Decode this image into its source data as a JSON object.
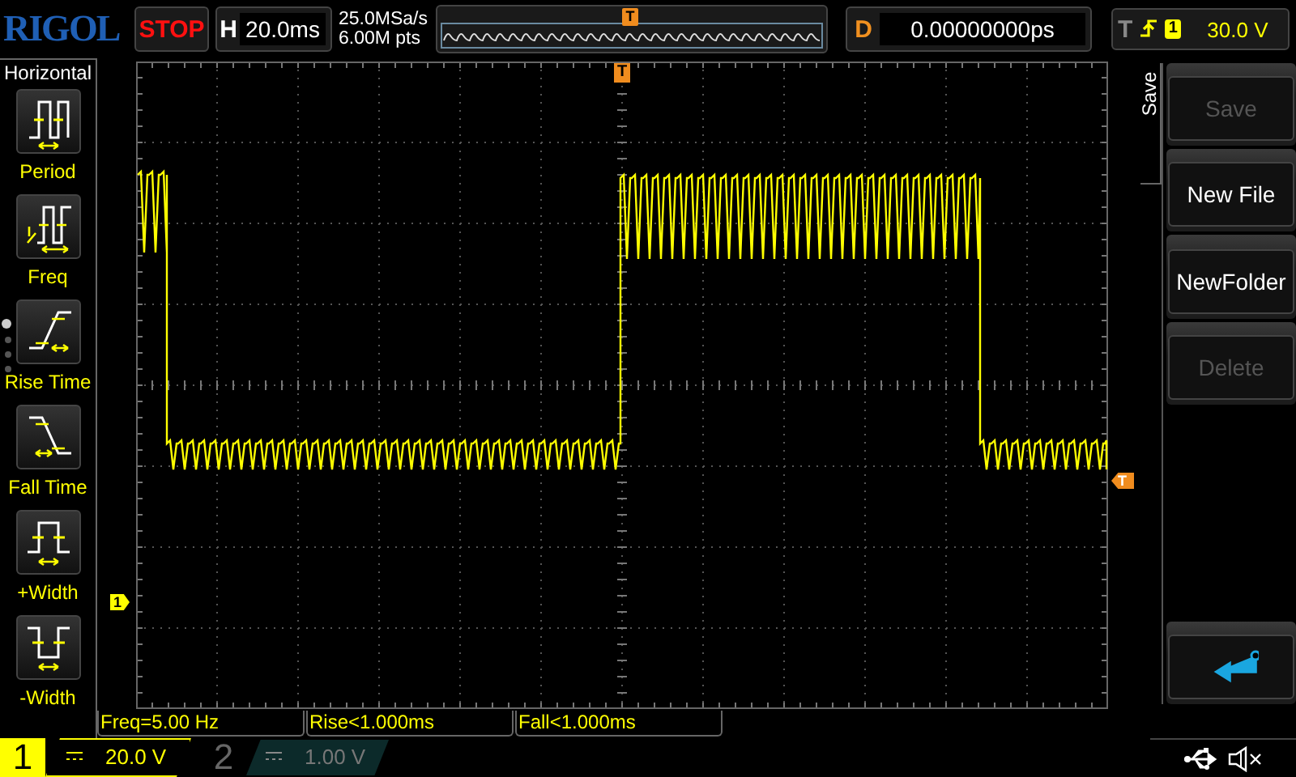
{
  "header": {
    "logo": "RIGOL",
    "run_state": "STOP",
    "horizontal": {
      "label": "H",
      "timebase": "20.0ms"
    },
    "sample_rate": "25.0MSa/s",
    "memory_depth": "6.00M pts",
    "overview": {
      "trigger_marker": "T"
    },
    "delay": {
      "label": "D",
      "value": "0.00000000ps"
    },
    "trigger": {
      "label": "T",
      "source": "1",
      "level": "30.0 V"
    }
  },
  "left_menu": {
    "title": "Horizontal",
    "items": [
      {
        "label": "Period",
        "kind": "period"
      },
      {
        "label": "Freq",
        "kind": "freq"
      },
      {
        "label": "Rise Time",
        "kind": "rise"
      },
      {
        "label": "Fall Time",
        "kind": "fall"
      },
      {
        "label": "+Width",
        "kind": "pwidth"
      },
      {
        "label": "-Width",
        "kind": "nwidth"
      }
    ],
    "pages": [
      {
        "selected": true
      },
      {
        "selected": false
      },
      {
        "selected": false
      },
      {
        "selected": false
      }
    ]
  },
  "screen": {
    "trigger_position_marker": "T",
    "channel_marker": "1",
    "trigger_level_marker": "T"
  },
  "measurements": [
    "Freq=5.00 Hz",
    "Rise<1.000ms",
    "Fall<1.000ms"
  ],
  "right_menu": {
    "title": "Save",
    "buttons": [
      {
        "kind": "text",
        "label": "Save",
        "disabled": true
      },
      {
        "kind": "text",
        "label": "New File",
        "disabled": false
      },
      {
        "kind": "text",
        "label": "NewFolder",
        "disabled": false
      },
      {
        "kind": "text",
        "label": "Delete",
        "disabled": true
      },
      {
        "kind": "return",
        "disabled": false
      }
    ]
  },
  "channels": [
    {
      "number": "1",
      "scale": "20.0 V",
      "active": true
    },
    {
      "number": "2",
      "scale": "1.00 V",
      "active": false
    }
  ]
}
